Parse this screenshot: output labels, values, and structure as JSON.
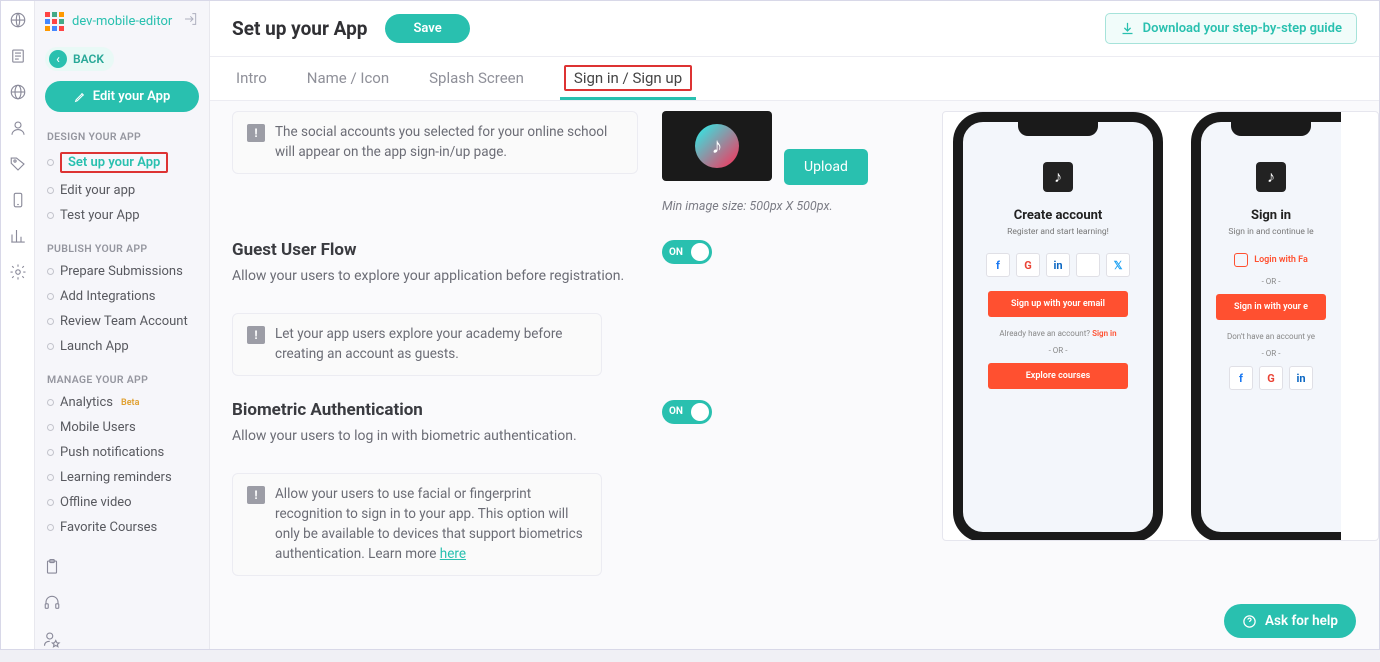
{
  "sidebar": {
    "title": "dev-mobile-editor",
    "back_label": "BACK",
    "edit_btn": "Edit your App",
    "section_design": "DESIGN YOUR APP",
    "design_items": [
      "Set up your App",
      "Edit your app",
      "Test your App"
    ],
    "section_publish": "PUBLISH YOUR APP",
    "publish_items": [
      "Prepare Submissions",
      "Add Integrations",
      "Review Team Account",
      "Launch App"
    ],
    "section_manage": "MANAGE YOUR APP",
    "manage_items": [
      "Analytics",
      "Mobile Users",
      "Push notifications",
      "Learning reminders",
      "Offline video",
      "Favorite Courses"
    ],
    "beta_label": "Beta"
  },
  "header": {
    "page_title": "Set up your App",
    "save_label": "Save",
    "download_guide": "Download your step-by-step guide"
  },
  "tabs": [
    "Intro",
    "Name / Icon",
    "Splash Screen",
    "Sign in / Sign up"
  ],
  "sections": {
    "social_note": "The social accounts you selected for your online school will appear on the app sign-in/up page.",
    "upload_row": {
      "upload_label": "Upload",
      "hint": "Min image size: 500px X 500px."
    },
    "guest": {
      "title": "Guest User Flow",
      "desc": "Allow your users to explore your application before registration.",
      "toggle": "ON",
      "note": "Let your app users explore your academy before creating an account as guests."
    },
    "biometric": {
      "title": "Biometric Authentication",
      "desc": "Allow your users to log in with biometric authentication.",
      "toggle": "ON",
      "note": "Allow your users to use facial or fingerprint recognition to sign in to your app. This option will only be available to devices that support biometrics authentication. Learn more ",
      "note_link": "here"
    }
  },
  "preview": {
    "phone1": {
      "title": "Create account",
      "subtitle": "Register and start learning!",
      "cta": "Sign up with your email",
      "already": "Already have an account? ",
      "signin": "Sign in",
      "or": "- OR -",
      "explore": "Explore courses"
    },
    "phone2": {
      "title": "Sign in",
      "subtitle": "Sign in and continue le",
      "faceid": "Login with Fa",
      "or": "- OR -",
      "cta": "Sign in with your e",
      "noacct": "Don't have an account ye",
      "or2": "- OR -"
    }
  },
  "ask_help": "Ask for help"
}
